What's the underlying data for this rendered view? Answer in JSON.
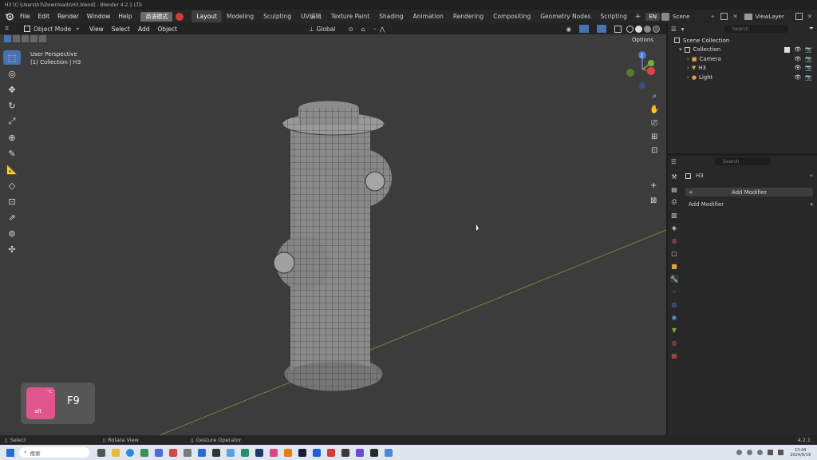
{
  "titlebar": {
    "text": "H3 [C:\\Users\\h3\\Downloads\\H3.blend] - Blender 4.2.1 LTS"
  },
  "menu": [
    "File",
    "Edit",
    "Render",
    "Window",
    "Help"
  ],
  "ime_label": "英语模式",
  "workspaces": [
    "Layout",
    "Modeling",
    "Sculpting",
    "UV编辑",
    "Texture Paint",
    "Shading",
    "Animation",
    "Rendering",
    "Compositing",
    "Geometry Nodes",
    "Scripting"
  ],
  "lang_badge": "EN",
  "scene_label": "Scene",
  "viewlayer_label": "ViewLayer",
  "viewport_header": {
    "mode": "Object Mode",
    "menus": [
      "View",
      "Select",
      "Add",
      "Object"
    ],
    "orientation": "Global",
    "options": "Options"
  },
  "overlay_text": {
    "perspective": "User Perspective",
    "collection": "(1) Collection | H3"
  },
  "key_overlay": {
    "modifier": "alt",
    "key": "F9"
  },
  "gizmo": {
    "z": "Z",
    "y": "Y",
    "x": "X"
  },
  "outliner": {
    "search_placeholder": "Search",
    "scene_collection": "Scene Collection",
    "collection": "Collection",
    "items": [
      "Camera",
      "H3",
      "Light"
    ]
  },
  "properties": {
    "search_placeholder": "Search",
    "object_name": "H3",
    "add_modifier_button": "Add Modifier",
    "add_modifier_menu": "Add Modifier"
  },
  "statusbar": {
    "select": "Select",
    "rotate": "Rotate View",
    "gesture": "Gesture Operator",
    "version": "4.2.1"
  },
  "taskbar": {
    "search_placeholder": "搜索",
    "time": "13:44",
    "date": "2024/9/19"
  },
  "colors": {
    "accent": "#4772b3",
    "viewport_bg": "#3c3c3c",
    "panel_bg": "#282828",
    "key_badge": "#e0558c"
  }
}
